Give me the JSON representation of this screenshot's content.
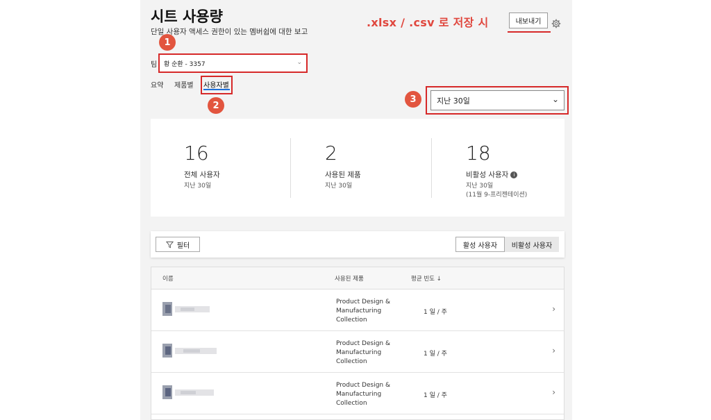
{
  "page": {
    "title": "시트 사용량",
    "subtitle": "단일 사용자 액세스 권한이 있는 멤버쉽에 대한 보고"
  },
  "annotation": {
    "export_note": ".xlsx / .csv 로 저장 시",
    "badges": [
      "1",
      "2",
      "3"
    ],
    "color": "#e2553f"
  },
  "header": {
    "export_label": "내보내기",
    "settings_icon": "gear-icon"
  },
  "team": {
    "label": "팀",
    "value": "황 순환 - 3357"
  },
  "tabs": [
    {
      "label": "요약"
    },
    {
      "label": "제품별"
    },
    {
      "label": "사용자별",
      "active": true
    }
  ],
  "date_range": {
    "value": "지난 30일"
  },
  "stats": [
    {
      "value": "16",
      "label": "전체 사용자",
      "sub": "지난 30일"
    },
    {
      "value": "2",
      "label": "사용된 제품",
      "sub": "지난 30일"
    },
    {
      "value": "18",
      "label": "비활성 사용자",
      "sub": "지난 30일",
      "sub2": "(11월 9-프리젠테이션)",
      "info_icon": "info-icon"
    }
  ],
  "toolbar": {
    "filter_label": "필터",
    "active_users_label": "활성 사용자",
    "inactive_users_label": "비활성 사용자"
  },
  "table": {
    "columns": [
      "이름",
      "사용된 제품",
      "평균 빈도 ↓"
    ],
    "rows": [
      {
        "product": "Product Design & Manufacturing Collection",
        "frequency": "1 일 / 주"
      },
      {
        "product": "Product Design & Manufacturing Collection",
        "frequency": "1 일 / 주"
      },
      {
        "product": "Product Design & Manufacturing Collection",
        "frequency": "1 일 / 주"
      }
    ]
  }
}
